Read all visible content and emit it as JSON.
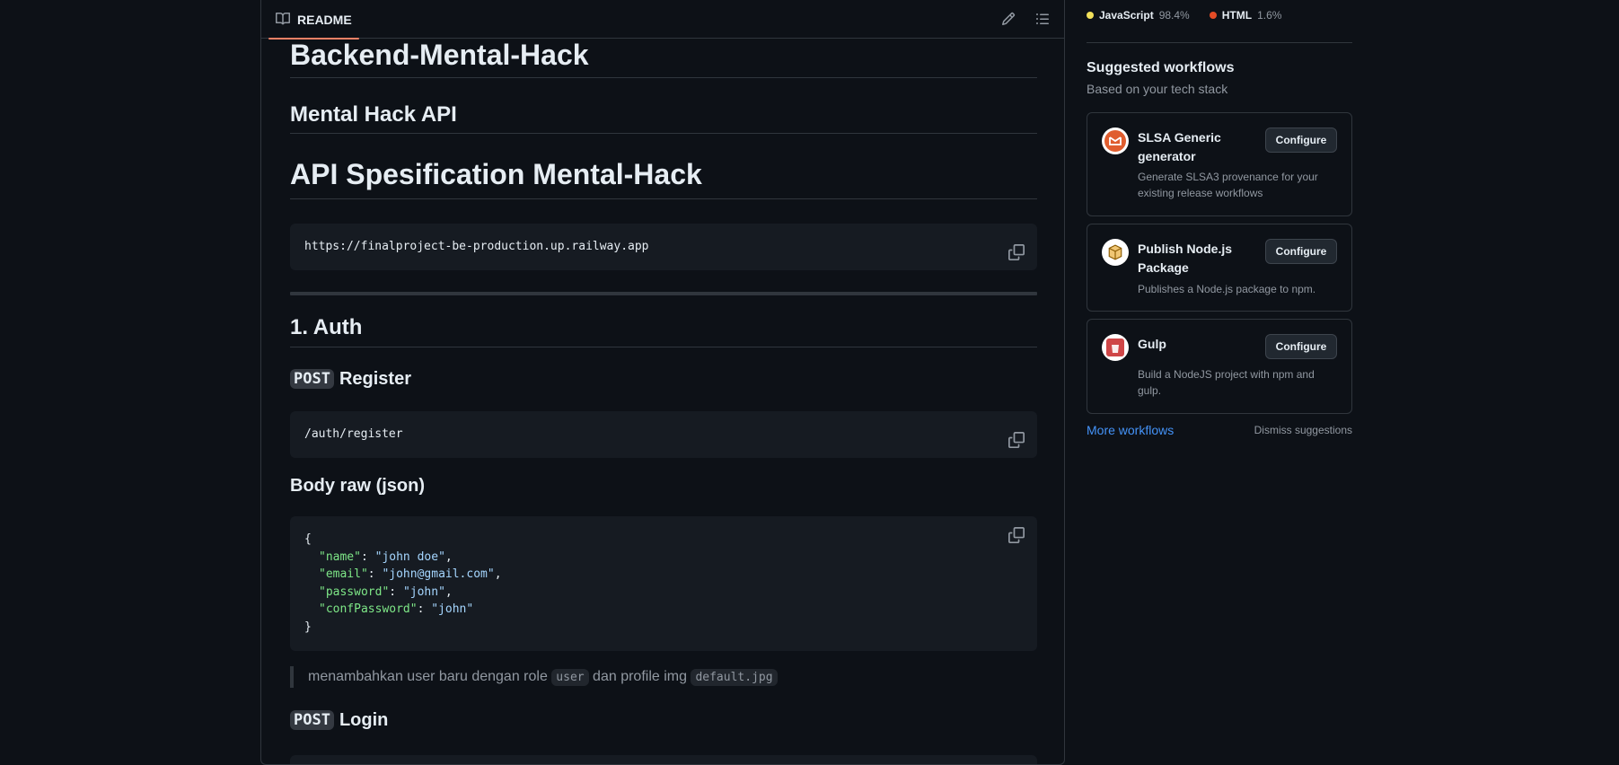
{
  "readme": {
    "tab_label": "README",
    "icons": {
      "tab": "book-icon",
      "edit": "pencil-icon",
      "outline": "list-unordered-icon",
      "copy": "copy-icon"
    }
  },
  "content": {
    "h1_backend": "Backend-Mental-Hack",
    "h2_api": "Mental Hack API",
    "h1_spec": "API Spesification Mental-Hack",
    "base_url": "https://finalproject-be-production.up.railway.app",
    "auth_heading": "1. Auth",
    "register": {
      "method": "POST",
      "title": "Register",
      "path": "/auth/register"
    },
    "body_heading": "Body raw (json)",
    "json_body": {
      "open": "{",
      "close": "}",
      "lines": [
        {
          "key": "\"name\"",
          "sep": ": ",
          "value": "\"john doe\"",
          "comma": ","
        },
        {
          "key": "\"email\"",
          "sep": ": ",
          "value": "\"john@gmail.com\"",
          "comma": ","
        },
        {
          "key": "\"password\"",
          "sep": ": ",
          "value": "\"john\"",
          "comma": ","
        },
        {
          "key": "\"confPassword\"",
          "sep": ": ",
          "value": "\"john\"",
          "comma": ""
        }
      ]
    },
    "note": {
      "part1": "menambahkan user baru dengan role ",
      "code1": "user",
      "part2": " dan profile img ",
      "code2": "default.jpg"
    },
    "login": {
      "method": "POST",
      "title": "Login"
    }
  },
  "sidebar": {
    "languages": [
      {
        "name": "JavaScript",
        "percent": "98.4%",
        "color": "#f1e05a"
      },
      {
        "name": "HTML",
        "percent": "1.6%",
        "color": "#e34c26"
      }
    ],
    "suggested_title": "Suggested workflows",
    "suggested_subtitle": "Based on your tech stack",
    "workflows": [
      {
        "name": "SLSA Generic generator",
        "description": "Generate SLSA3 provenance for your existing release workflows",
        "button": "Configure",
        "icon": "slsa-logo-icon"
      },
      {
        "name": "Publish Node.js Package",
        "description": "Publishes a Node.js package to npm.",
        "button": "Configure",
        "icon": "npm-package-icon"
      },
      {
        "name": "Gulp",
        "description": "Build a NodeJS project with npm and gulp.",
        "button": "Configure",
        "icon": "gulp-logo-icon"
      }
    ],
    "more_workflows": "More workflows",
    "dismiss": "Dismiss suggestions"
  }
}
